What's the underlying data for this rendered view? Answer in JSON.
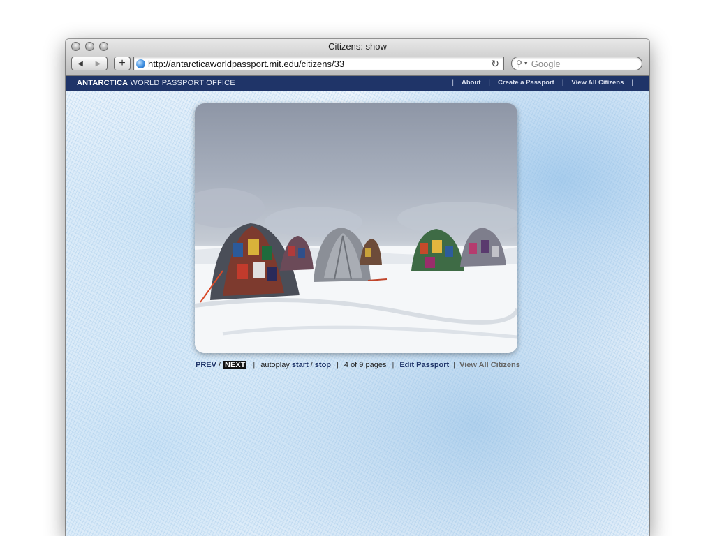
{
  "browser": {
    "window_title": "Citizens: show",
    "url": "http://antarcticaworldpassport.mit.edu/citizens/33",
    "search_placeholder": "Google"
  },
  "site": {
    "brand_bold": "ANTARCTICA",
    "brand_rest": " WORLD PASSPORT OFFICE",
    "nav": [
      {
        "label": "About"
      },
      {
        "label": "Create a Passport"
      },
      {
        "label": "View All Citizens"
      }
    ]
  },
  "pager": {
    "prev": "PREV",
    "slash": "/",
    "next": "NEXT",
    "autoplay_label": "autoplay",
    "start": "start",
    "stop": "stop",
    "page_info": "4 of 9 pages",
    "edit": "Edit Passport",
    "view_all": "View All Citizens"
  },
  "colors": {
    "header_bg": "#1f3468",
    "link": "#1f3468"
  }
}
